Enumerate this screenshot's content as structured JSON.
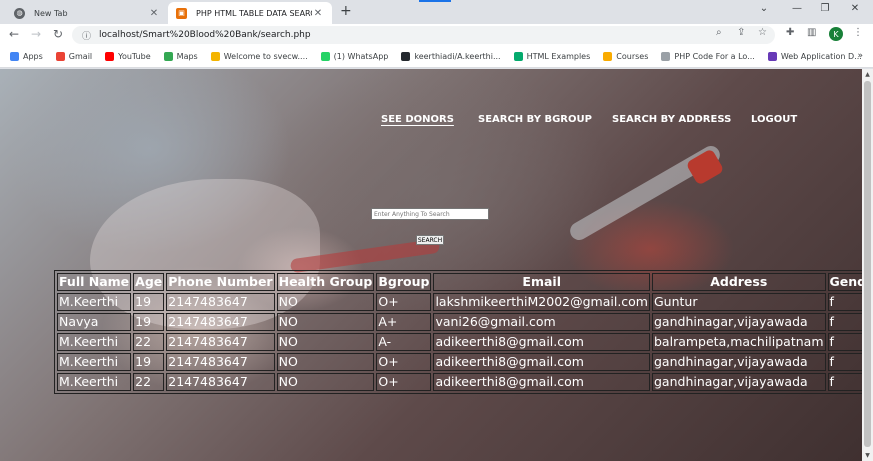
{
  "browser": {
    "tabs": [
      {
        "title": "New Tab",
        "close": "✕"
      },
      {
        "title": "PHP HTML TABLE DATA SEARCH",
        "close": "✕"
      }
    ],
    "new_tab": "+",
    "window_controls": {
      "minimize": "⌄",
      "restore": "—",
      "maximize": "❐",
      "close": "✕"
    },
    "nav": {
      "back": "←",
      "forward": "→",
      "reload": "↻"
    },
    "url": "localhost/Smart%20Blood%20Bank/search.php",
    "profile_initial": "K",
    "bookmarks": [
      {
        "label": "Apps",
        "color": "#4285f4"
      },
      {
        "label": "Gmail",
        "color": "#ea4335"
      },
      {
        "label": "YouTube",
        "color": "#ff0000"
      },
      {
        "label": "Maps",
        "color": "#34a853"
      },
      {
        "label": "Welcome to svecw....",
        "color": "#f4b400"
      },
      {
        "label": "(1) WhatsApp",
        "color": "#25d366"
      },
      {
        "label": "keerthiadi/A.keerthi...",
        "color": "#24292e"
      },
      {
        "label": "HTML Examples",
        "color": "#04aa6d"
      },
      {
        "label": "Courses",
        "color": "#f9ab00"
      },
      {
        "label": "PHP Code For a Lo...",
        "color": "#9aa0a6"
      },
      {
        "label": "Web Application D...",
        "color": "#673ab7"
      }
    ],
    "bookmarks_more": "»"
  },
  "page": {
    "nav": {
      "see_donors": "SEE DONORS",
      "search_by_bgroup": "SEARCH BY BGROUP",
      "search_by_address": "SEARCH BY ADDRESS",
      "logout": "LOGOUT"
    },
    "search": {
      "placeholder": "Enter Anything To Search",
      "value": "",
      "button": "SEARCH"
    },
    "table": {
      "headers": [
        "Full Name",
        "Age",
        "Phone Number",
        "Health Group",
        "Bgroup",
        "Email",
        "Address",
        "Gender"
      ],
      "rows": [
        [
          "M.Keerthi",
          "19",
          "2147483647",
          "NO",
          "O+",
          "lakshmikeerthiM2002@gmail.com",
          "Guntur",
          "f"
        ],
        [
          "Navya",
          "19",
          "2147483647",
          "NO",
          "A+",
          "vani26@gmail.com",
          "gandhinagar,vijayawada",
          "f"
        ],
        [
          "M.Keerthi",
          "22",
          "2147483647",
          "NO",
          "A-",
          "adikeerthi8@gmail.com",
          "balrampeta,machilipatnam",
          "f"
        ],
        [
          "M.Keerthi",
          "19",
          "2147483647",
          "NO",
          "O+",
          "adikeerthi8@gmail.com",
          "gandhinagar,vijayawada",
          "f"
        ],
        [
          "M.Keerthi",
          "22",
          "2147483647",
          "NO",
          "O+",
          "adikeerthi8@gmail.com",
          "gandhinagar,vijayawada",
          "f"
        ]
      ]
    }
  },
  "icons": {
    "tab_favicon": "globe-icon",
    "active_favicon": "php-icon",
    "info": "info-icon",
    "zoom": "zoom-icon",
    "share": "share-icon",
    "bookmark_star": "star-icon",
    "extensions": "puzzle-icon",
    "sidepanel": "sidepanel-icon",
    "menu": "kebab-menu-icon"
  }
}
